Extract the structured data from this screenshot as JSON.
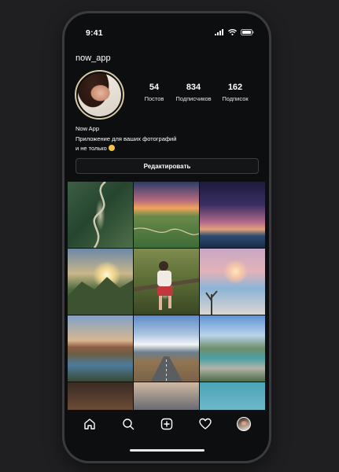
{
  "status_bar": {
    "time": "9:41",
    "icons": [
      "signal-icon",
      "wifi-icon",
      "battery-icon"
    ]
  },
  "profile": {
    "username": "now_app",
    "stats": [
      {
        "value": "54",
        "label": "Постов"
      },
      {
        "value": "834",
        "label": "Подписчиков"
      },
      {
        "value": "162",
        "label": "Подписок"
      }
    ],
    "bio_name": "Now App",
    "bio_line1": "Приложение для ваших фотографий",
    "bio_line2": "и не только",
    "edit_button": "Редактировать"
  },
  "grid": {
    "photos": [
      "winding-road-aerial",
      "sunset-hills-road",
      "milky-way-lake",
      "mountain-sunrise",
      "woman-on-tree",
      "moon-over-sea-clouds",
      "mountain-lake-reflection",
      "snow-peak-road",
      "alpine-river",
      "rock-landscape",
      "dusk-mountains",
      "turquoise-water-palm"
    ]
  },
  "bottom_nav": {
    "items": [
      "home-icon",
      "search-icon",
      "add-post-icon",
      "heart-icon",
      "profile-avatar"
    ]
  },
  "colors": {
    "background": "#1f1f21",
    "screen": "#0d0e10",
    "phone_frame": "#3a3b3e",
    "avatar_ring": "#d8c9a6"
  }
}
